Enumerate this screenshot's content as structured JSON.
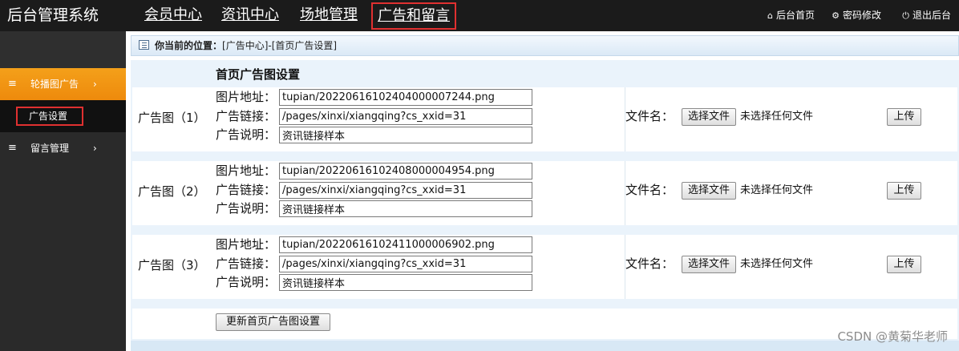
{
  "app": {
    "title": "后台管理系统"
  },
  "topnav": {
    "items": [
      {
        "label": "会员中心"
      },
      {
        "label": "资讯中心"
      },
      {
        "label": "场地管理"
      },
      {
        "label": "广告和留言"
      }
    ]
  },
  "toplinks": {
    "home": {
      "icon": "home-icon",
      "label": "后台首页"
    },
    "password": {
      "icon": "gear-icon",
      "label": "密码修改"
    },
    "logout": {
      "icon": "power-icon",
      "label": "退出后台"
    }
  },
  "sidebar": {
    "group1": {
      "icon": "menu-icon",
      "label": "轮播图广告",
      "chevron": "›"
    },
    "sub_item": "广告设置",
    "group2": {
      "icon": "menu-icon",
      "label": "留言管理",
      "chevron": "›"
    }
  },
  "breadcrumb": {
    "prefix": "你当前的位置：",
    "path": "[广告中心]-[首页广告设置]"
  },
  "section_title": "首页广告图设置",
  "field_labels": {
    "image": "图片地址：",
    "link": "广告链接：",
    "desc": "广告说明："
  },
  "ads": [
    {
      "label": "广告图（1）",
      "image": "tupian/20220616102404000007244.png",
      "link": "/pages/xinxi/xiangqing?cs_xxid=31",
      "desc": "资讯链接样本"
    },
    {
      "label": "广告图（2）",
      "image": "tupian/20220616102408000004954.png",
      "link": "/pages/xinxi/xiangqing?cs_xxid=31",
      "desc": "资讯链接样本"
    },
    {
      "label": "广告图（3）",
      "image": "tupian/20220616102411000006902.png",
      "link": "/pages/xinxi/xiangqing?cs_xxid=31",
      "desc": "资讯链接样本"
    }
  ],
  "file": {
    "label": "文件名：",
    "choose_button": "选择文件",
    "no_file_text": "未选择任何文件",
    "upload_button": "上传"
  },
  "update_button": "更新首页广告图设置",
  "watermark": "CSDN @黄菊华老师",
  "colors": {
    "accent": "#ee8a0c",
    "highlight_border": "#e03030",
    "topbar": "#1b1b1b"
  }
}
